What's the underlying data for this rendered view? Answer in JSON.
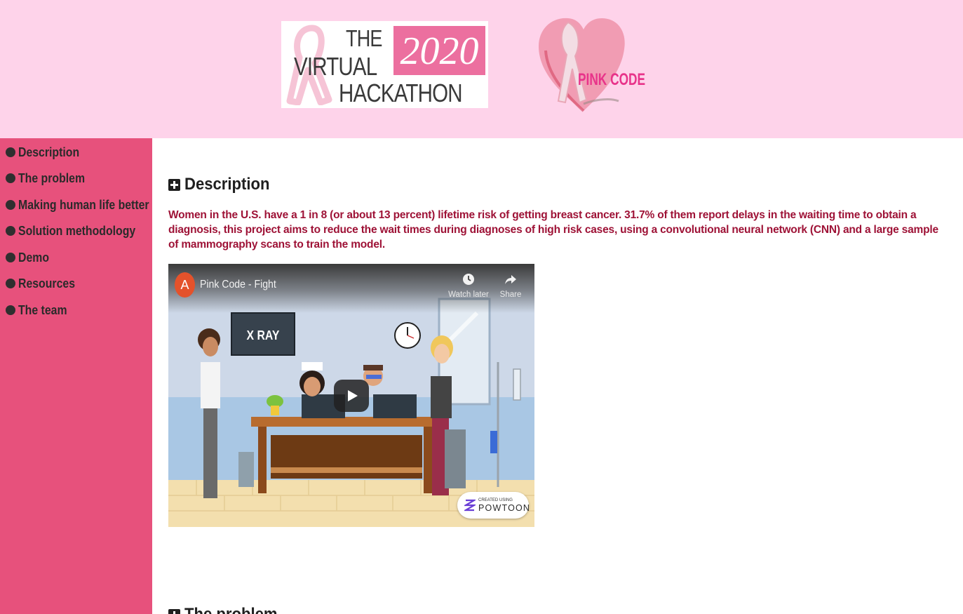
{
  "header": {
    "hackathon_logo": {
      "line1": "THE",
      "line2": "VIRTUAL",
      "line3": "HACKATHON",
      "year": "2020"
    },
    "pinkcode_logo": {
      "text": "PINK CODE"
    }
  },
  "sidebar": {
    "items": [
      {
        "label": "Description"
      },
      {
        "label": "The problem"
      },
      {
        "label": "Making human life better"
      },
      {
        "label": "Solution methodology"
      },
      {
        "label": "Demo"
      },
      {
        "label": "Resources"
      },
      {
        "label": "The team"
      }
    ]
  },
  "main": {
    "description": {
      "title": "Description",
      "text": "Women in the U.S. have a 1 in 8 (or about 13 percent) lifetime risk of getting breast cancer. 31.7% of them report delays in the waiting time to obtain a diagnosis, this project aims to reduce the wait times during diagnoses of high risk cases, using a convolutional neural network (CNN) and a large sample of mammography scans to train the model."
    },
    "video": {
      "channel_initial": "A",
      "title": "Pink Code - Fight",
      "watch_later": "Watch later",
      "share": "Share",
      "scene_text": "X RAY",
      "badge_small": "CREATED USING",
      "badge_big": "POWTOON"
    },
    "problem": {
      "title": "The problem"
    }
  },
  "colors": {
    "header_bg": "#fed3ea",
    "sidebar_bg": "#e7517c",
    "description_text": "#9e1236",
    "logo_accent": "#ec6f9f"
  }
}
